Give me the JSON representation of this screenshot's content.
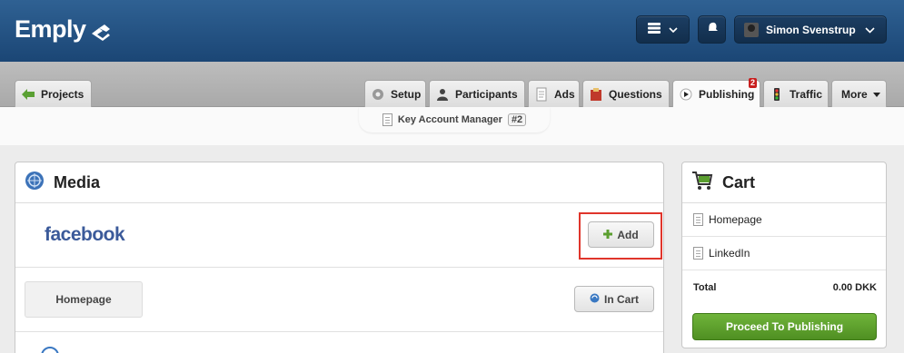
{
  "header": {
    "logo_text": "Emply",
    "user_name": "Simon Svenstrup"
  },
  "tabs": {
    "projects": "Projects",
    "setup": "Setup",
    "participants": "Participants",
    "ads": "Ads",
    "questions": "Questions",
    "publishing": "Publishing",
    "publishing_badge": "2",
    "traffic": "Traffic",
    "more": "More"
  },
  "job": {
    "title": "Key Account Manager",
    "number": "#2"
  },
  "media": {
    "title": "Media",
    "rows": [
      {
        "name": "facebook",
        "action": "Add"
      },
      {
        "name": "Homepage",
        "action": "In Cart"
      }
    ]
  },
  "cart": {
    "title": "Cart",
    "items": [
      "Homepage",
      "LinkedIn"
    ],
    "total_label": "Total",
    "total_value": "0.00 DKK",
    "proceed_label": "Proceed To Publishing"
  },
  "colors": {
    "header": "#1f4d7f",
    "proceed": "#5c9e2c",
    "highlight": "#e0352b",
    "facebook": "#3b5a9a"
  }
}
